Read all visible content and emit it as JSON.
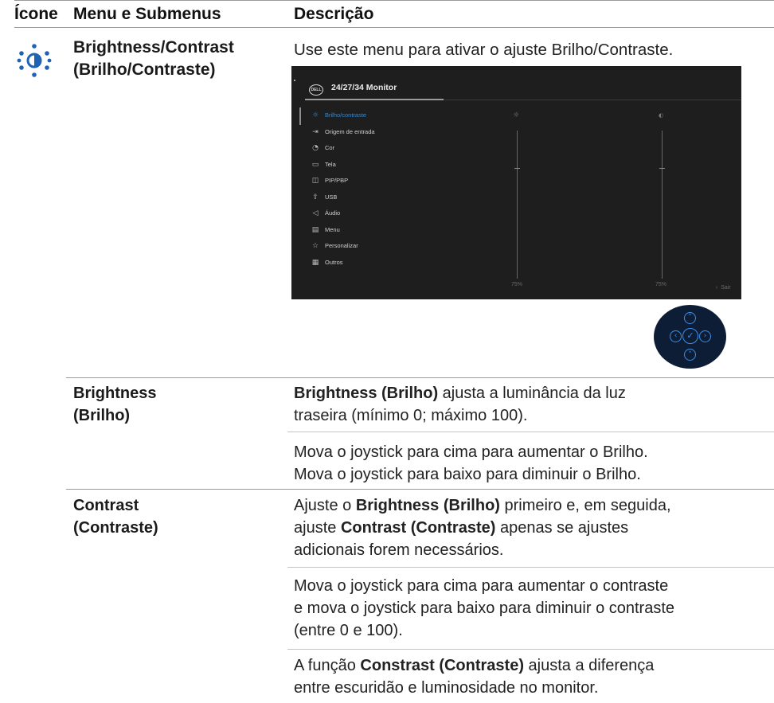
{
  "header": {
    "col_icon": "Ícone",
    "col_menu": "Menu e Submenus",
    "col_desc": "Descrição"
  },
  "main": {
    "icon_name": "brightness-contrast-icon",
    "title_line1": "Brightness/Contrast",
    "title_line2": "(Brilho/Contraste)",
    "intro": "Use este menu para ativar o ajuste Brilho/Contraste."
  },
  "osd": {
    "brand": "DELL",
    "title": "24/27/34 Monitor",
    "items": [
      {
        "icon": "sun-icon",
        "glyph": "☼",
        "label": "Brilho/contraste",
        "selected": true
      },
      {
        "icon": "input-source-icon",
        "glyph": "⇥",
        "label": "Origem de entrada",
        "selected": false
      },
      {
        "icon": "color-palette-icon",
        "glyph": "◔",
        "label": "Cor",
        "selected": false
      },
      {
        "icon": "display-icon",
        "glyph": "▭",
        "label": "Tela",
        "selected": false
      },
      {
        "icon": "pip-pbp-icon",
        "glyph": "◫",
        "label": "PIP/PBP",
        "selected": false
      },
      {
        "icon": "usb-icon",
        "glyph": "⇧",
        "label": "USB",
        "selected": false
      },
      {
        "icon": "speaker-icon",
        "glyph": "◁",
        "label": "Áudio",
        "selected": false
      },
      {
        "icon": "menu-icon",
        "glyph": "▤",
        "label": "Menu",
        "selected": false
      },
      {
        "icon": "star-icon",
        "glyph": "☆",
        "label": "Personalizar",
        "selected": false
      },
      {
        "icon": "others-icon",
        "glyph": "▦",
        "label": "Outros",
        "selected": false
      }
    ],
    "brightness_value": "75%",
    "contrast_value": "75%",
    "brightness_level": 0.75,
    "contrast_level": 0.75,
    "exit_label": "Sair"
  },
  "joystick": {
    "up_icon": "chevron-up-icon",
    "down_icon": "chevron-down-icon",
    "left_icon": "chevron-left-icon",
    "right_icon": "chevron-right-icon",
    "center_icon": "check-icon"
  },
  "brightness": {
    "label_line1": "Brightness",
    "label_line2": "(Brilho)",
    "desc1_bold": "Brightness (Brilho)",
    "desc1_rest_a": " ajusta a luminância da luz",
    "desc1_rest_b": "traseira  (mínimo 0; máximo 100).",
    "desc2_line1": "Mova o joystick para cima para aumentar o Brilho.",
    "desc2_line2": "Mova o joystick para baixo para diminuir o Brilho."
  },
  "contrast": {
    "label_line1": "Contrast",
    "label_line2": "(Contraste)",
    "p1_a": "Ajuste o ",
    "p1_b": "Brightness (Brilho)",
    "p1_c": " primeiro e, em seguida,",
    "p1_d": "ajuste ",
    "p1_e": "Contrast (Contraste)",
    "p1_f": " apenas se ajustes",
    "p1_g": "adicionais forem necessários.",
    "p2_line1": "Mova o joystick para cima  para aumentar o contraste",
    "p2_line2": "e mova o joystick para baixo  para diminuir o contraste",
    "p2_line3": "(entre 0 e 100).",
    "p3_a": "A função ",
    "p3_b": "Constrast (Contraste)",
    "p3_c": " ajusta a diferença",
    "p3_d": "entre escuridão e luminosidade no monitor."
  }
}
